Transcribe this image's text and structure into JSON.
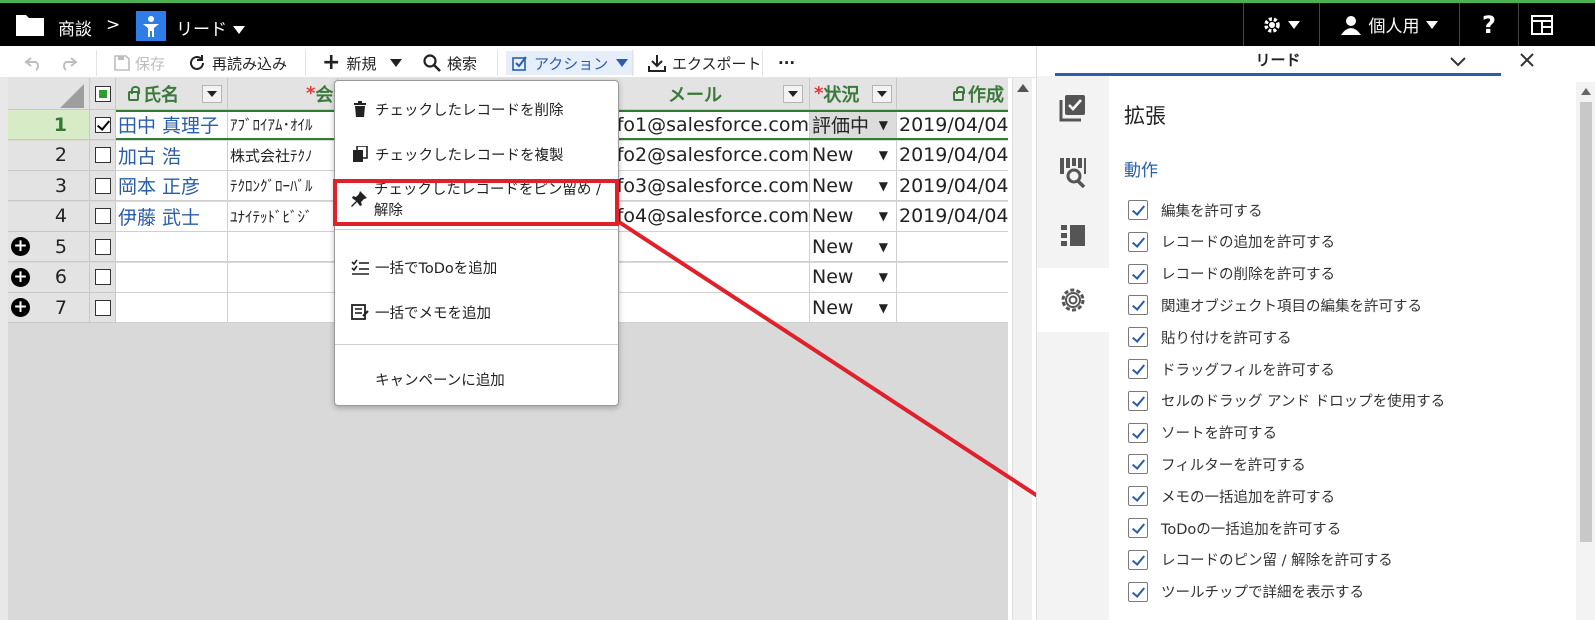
{
  "topbar": {
    "crumb_parent": "商談",
    "crumb_sep": ">",
    "crumb_current": "リード",
    "user_menu": "個人用",
    "help": "?"
  },
  "toolbar": {
    "save": "保存",
    "reload": "再読み込み",
    "new": "新規",
    "search": "検索",
    "action": "アクション",
    "export": "エクスポート",
    "more": "···"
  },
  "grid": {
    "columns": [
      "氏名",
      "会",
      "メール",
      "状況",
      "作成"
    ],
    "rows": [
      {
        "num": "1",
        "checked": true,
        "name": "田中 真理子",
        "company": "ｱﾌﾞﾛｲｱﾑ･ｵｲﾙ",
        "email": "fo1@salesforce.com",
        "status": "評価中",
        "created": "2019/04/04"
      },
      {
        "num": "2",
        "checked": false,
        "name": "加古 浩",
        "company": "株式会社ﾃｸﾉ",
        "email": "fo2@salesforce.com",
        "status": "New",
        "created": "2019/04/04"
      },
      {
        "num": "3",
        "checked": false,
        "name": "岡本 正彦",
        "company": "ﾃｸﾛﾝｸﾞﾛｰﾊﾞﾙ",
        "email": "fo3@salesforce.com",
        "status": "New",
        "created": "2019/04/04"
      },
      {
        "num": "4",
        "checked": false,
        "name": "伊藤 武士",
        "company": "ﾕﾅｲﾃｯﾄﾞﾋﾞｼﾞ",
        "email": "fo4@salesforce.com",
        "status": "New",
        "created": "2019/04/04"
      },
      {
        "num": "5",
        "checked": false,
        "name": "",
        "company": "",
        "email": "",
        "status": "New",
        "created": ""
      },
      {
        "num": "6",
        "checked": false,
        "name": "",
        "company": "",
        "email": "",
        "status": "New",
        "created": ""
      },
      {
        "num": "7",
        "checked": false,
        "name": "",
        "company": "",
        "email": "",
        "status": "New",
        "created": ""
      }
    ]
  },
  "menu": {
    "items": [
      "チェックしたレコードを削除",
      "チェックしたレコードを複製",
      "チェックしたレコードをピン留め / 解除",
      "一括でToDoを追加",
      "一括でメモを追加",
      "キャンペーンに追加"
    ]
  },
  "panel": {
    "tab_title": "リード",
    "heading": "拡張",
    "section": "動作",
    "options": [
      "編集を許可する",
      "レコードの追加を許可する",
      "レコードの削除を許可する",
      "関連オブジェクト項目の編集を許可する",
      "貼り付けを許可する",
      "ドラッグフィルを許可する",
      "セルのドラッグ アンド ドロップを使用する",
      "ソートを許可する",
      "フィルターを許可する",
      "メモの一括追加を許可する",
      "ToDoの一括追加を許可する",
      "レコードのピン留 / 解除を許可する",
      "ツールチップで詳細を表示する"
    ]
  },
  "colors": {
    "accent": "#2a5dab",
    "highlight": "#e0202a",
    "header_text": "#3b7a3b",
    "top_border": "#4caf50"
  }
}
